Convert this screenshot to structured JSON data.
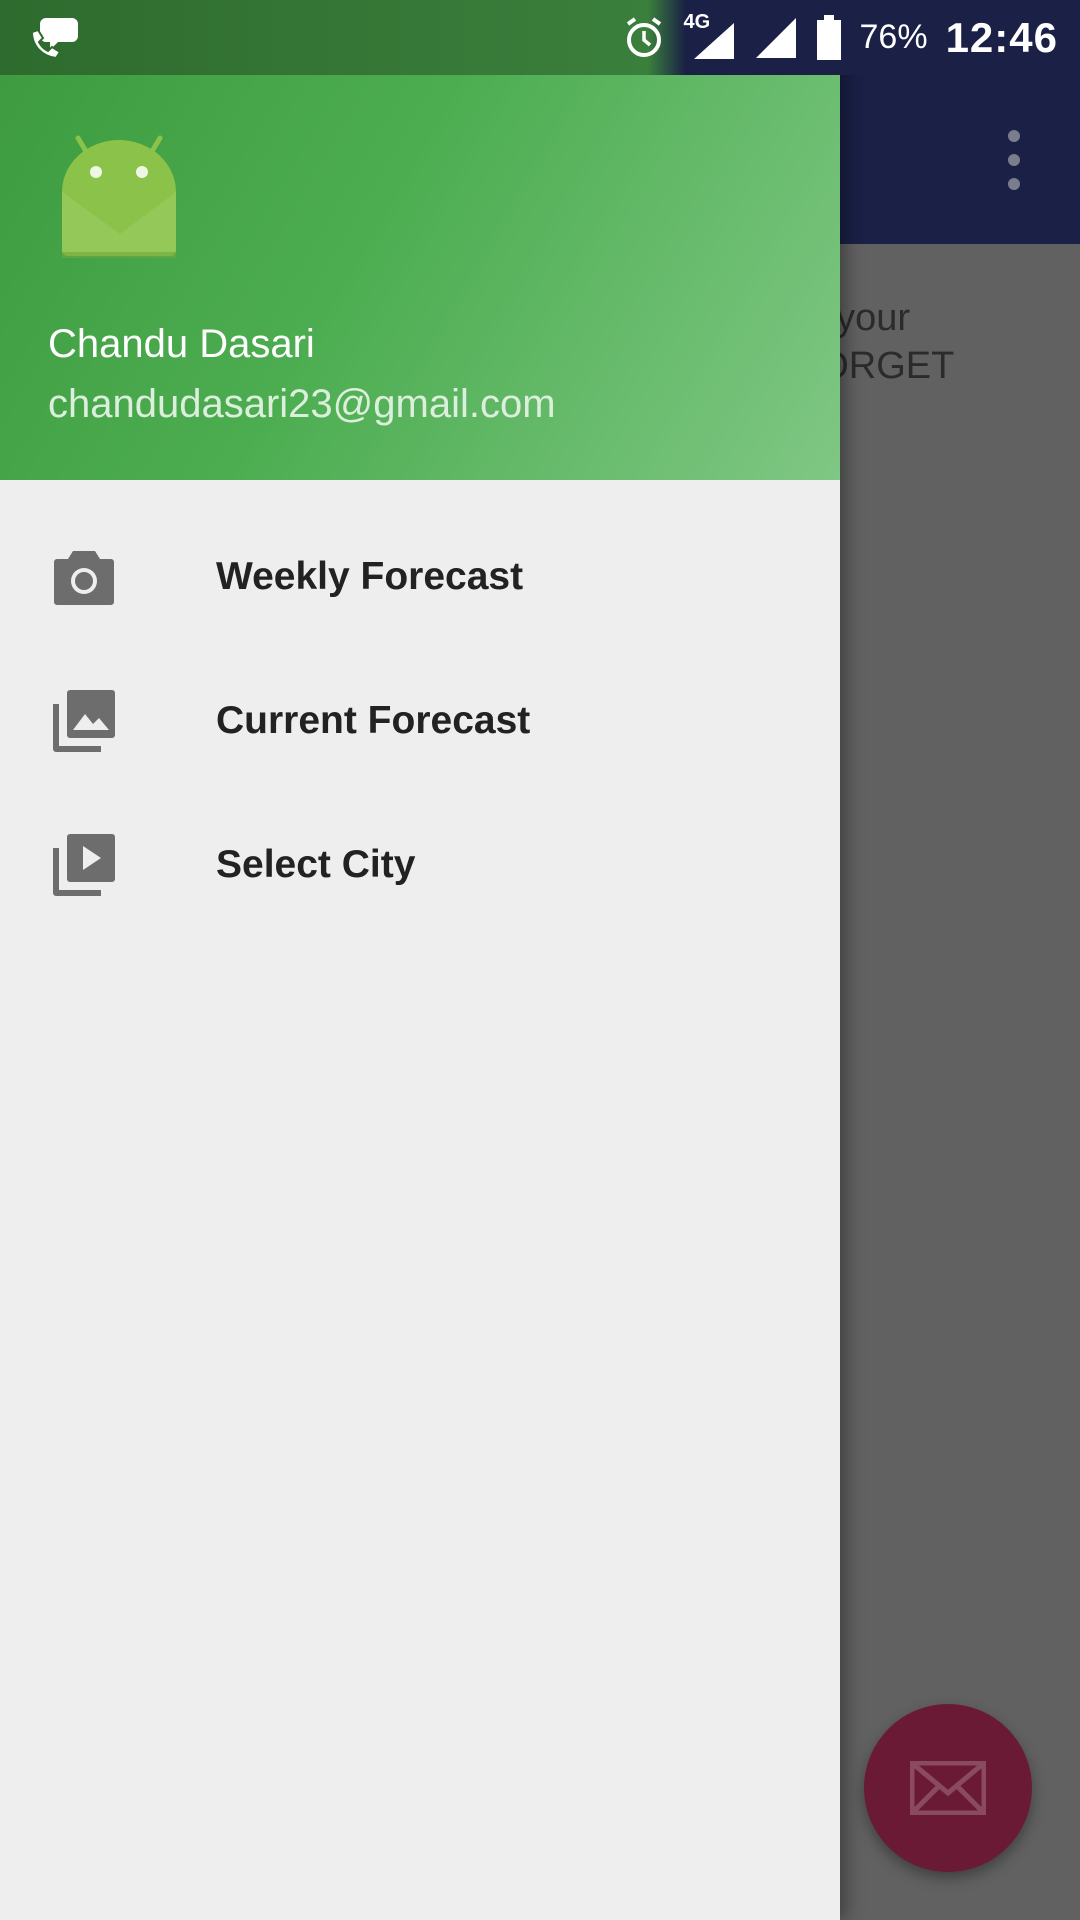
{
  "status_bar": {
    "battery_percent": "76%",
    "time": "12:46",
    "network": "4G",
    "icons": [
      "call-chat-icon",
      "alarm-icon",
      "signal-4g-icon",
      "signal-icon",
      "battery-icon"
    ]
  },
  "background_app": {
    "content_text": "ct your\nFORGET",
    "fab_icon": "email-icon",
    "overflow_icon": "more-vert-icon"
  },
  "drawer": {
    "header": {
      "avatar_icon": "android-icon",
      "user_name": "Chandu Dasari",
      "user_email": "chandudasari23@gmail.com"
    },
    "items": [
      {
        "label": "Weekly Forecast",
        "icon": "camera-icon"
      },
      {
        "label": "Current Forecast",
        "icon": "gallery-icon"
      },
      {
        "label": "Select City",
        "icon": "video-library-icon"
      }
    ]
  },
  "colors": {
    "header_gradient_start": "#3d9a3e",
    "header_gradient_end": "#7fc784",
    "toolbar": "#1a2046",
    "fab": "#6b1a36",
    "drawer_bg": "#eeeeee",
    "menu_icon": "#6d6d6d"
  }
}
